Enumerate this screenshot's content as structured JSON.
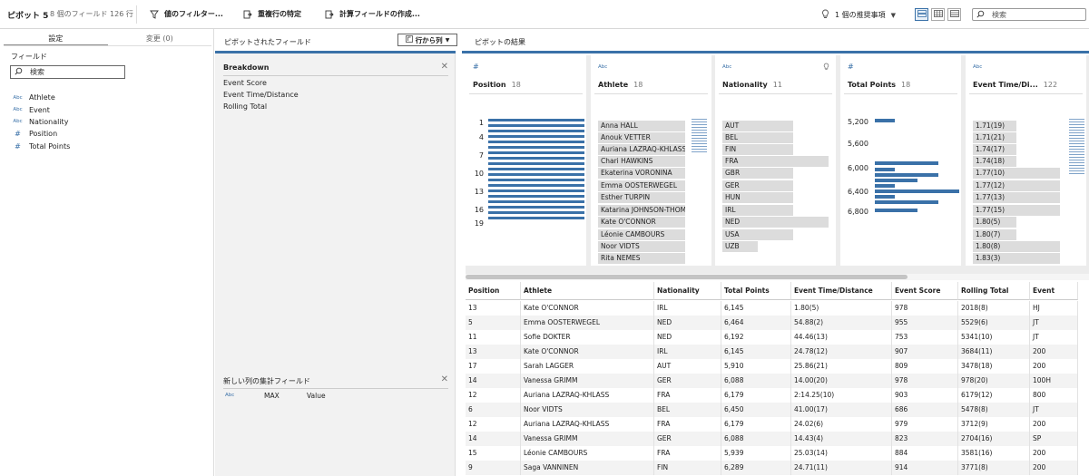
{
  "topbar": {
    "title": "ピボット 5",
    "subtitle": "8 個のフィールド  126 行",
    "filter_btn": "値のフィルター...",
    "dupes_btn": "重複行の特定",
    "calc_btn": "計算フィールドの作成...",
    "recommend": "1 個の推奨事項",
    "search_placeholder": "検索"
  },
  "left": {
    "tab_settings": "設定",
    "tab_changes": "変更 (0)",
    "fields_title": "フィールド",
    "search_placeholder": "検索",
    "fields": [
      {
        "icon": "Abc",
        "name": "Athlete"
      },
      {
        "icon": "Abc",
        "name": "Event"
      },
      {
        "icon": "Abc",
        "name": "Nationality"
      },
      {
        "icon": "#",
        "name": "Position"
      },
      {
        "icon": "#",
        "name": "Total Points"
      }
    ]
  },
  "middle": {
    "title": "ピボットされたフィールド",
    "dropdown": "行から列",
    "breakdown_title": "Breakdown",
    "breakdown_items": [
      "Event Score",
      "Event Time/Distance",
      "Rolling Total"
    ],
    "agg_title": "新しい列の集計フィールド",
    "agg_icon": "Abc",
    "agg_func": "MAX",
    "agg_field": "Value"
  },
  "right": {
    "title": "ピボットの結果",
    "cards": [
      {
        "type": "#",
        "name": "Position",
        "count": "18",
        "axis": [
          "1",
          "4",
          "7",
          "10",
          "13",
          "16",
          "19"
        ]
      },
      {
        "type": "Abc",
        "name": "Athlete",
        "count": "18",
        "values": [
          "Anna HALL",
          "Anouk VETTER",
          "Auriana LAZRAQ-KHLASS",
          "Chari HAWKINS",
          "Ekaterina VORONINA",
          "Emma OOSTERWEGEL",
          "Esther TURPIN",
          "Katarina JOHNSON-THOMPSON",
          "Kate O'CONNOR",
          "Léonie CAMBOURS",
          "Noor VIDTS",
          "Rita NEMES"
        ],
        "fill": [
          0.75,
          0.75,
          0.75,
          0.75,
          0.75,
          0.75,
          0.75,
          0.75,
          0.75,
          0.75,
          0.75,
          0.75
        ]
      },
      {
        "type": "Abc",
        "name": "Nationality",
        "count": "11",
        "values": [
          "AUT",
          "BEL",
          "FIN",
          "FRA",
          "GBR",
          "GER",
          "HUN",
          "IRL",
          "NED",
          "USA",
          "UZB"
        ],
        "fill": [
          0.67,
          0.67,
          0.67,
          1.0,
          0.67,
          0.67,
          0.67,
          0.67,
          1.0,
          0.67,
          0.33
        ]
      },
      {
        "type": "#",
        "name": "Total Points",
        "count": "18",
        "axis": [
          "5,200",
          "5,600",
          "6,000",
          "6,400",
          "6,800"
        ]
      },
      {
        "type": "Abc",
        "name": "Event Time/Di...",
        "count": "122",
        "values": [
          "1.71(19)",
          "1.71(21)",
          "1.74(17)",
          "1.74(18)",
          "1.77(10)",
          "1.77(12)",
          "1.77(13)",
          "1.77(15)",
          "1.80(5)",
          "1.80(7)",
          "1.80(8)",
          "1.83(3)"
        ],
        "fill": [
          0.5,
          0.5,
          0.5,
          0.5,
          1.0,
          1.0,
          1.0,
          1.0,
          0.5,
          0.5,
          1.0,
          1.0
        ]
      }
    ],
    "columns": [
      "Position",
      "Athlete",
      "Nationality",
      "Total Points",
      "Event Time/Distance",
      "Event Score",
      "Rolling Total",
      "Event"
    ],
    "rows": [
      [
        "13",
        "Kate O'CONNOR",
        "IRL",
        "6,145",
        "1.80(5)",
        "978",
        "2018(8)",
        "HJ"
      ],
      [
        "5",
        "Emma OOSTERWEGEL",
        "NED",
        "6,464",
        "54.88(2)",
        "955",
        "5529(6)",
        "JT"
      ],
      [
        "11",
        "Sofie DOKTER",
        "NED",
        "6,192",
        "44.46(13)",
        "753",
        "5341(10)",
        "JT"
      ],
      [
        "13",
        "Kate O'CONNOR",
        "IRL",
        "6,145",
        "24.78(12)",
        "907",
        "3684(11)",
        "200"
      ],
      [
        "17",
        "Sarah LAGGER",
        "AUT",
        "5,910",
        "25.86(21)",
        "809",
        "3478(18)",
        "200"
      ],
      [
        "14",
        "Vanessa GRIMM",
        "GER",
        "6,088",
        "14.00(20)",
        "978",
        "978(20)",
        "100H"
      ],
      [
        "12",
        "Auriana LAZRAQ-KHLASS",
        "FRA",
        "6,179",
        "2:14.25(10)",
        "903",
        "6179(12)",
        "800"
      ],
      [
        "6",
        "Noor VIDTS",
        "BEL",
        "6,450",
        "41.00(17)",
        "686",
        "5478(8)",
        "JT"
      ],
      [
        "12",
        "Auriana LAZRAQ-KHLASS",
        "FRA",
        "6,179",
        "24.02(6)",
        "979",
        "3712(9)",
        "200"
      ],
      [
        "14",
        "Vanessa GRIMM",
        "GER",
        "6,088",
        "14.43(4)",
        "823",
        "2704(16)",
        "SP"
      ],
      [
        "15",
        "Léonie CAMBOURS",
        "FRA",
        "5,939",
        "25.03(14)",
        "884",
        "3581(16)",
        "200"
      ],
      [
        "9",
        "Saga VANNINEN",
        "FIN",
        "6,289",
        "24.71(11)",
        "914",
        "3771(8)",
        "200"
      ]
    ]
  },
  "colors": {
    "accent": "#3a71a8",
    "bar": "#dcdcdc",
    "panel_bg": "#f2f2f2"
  }
}
